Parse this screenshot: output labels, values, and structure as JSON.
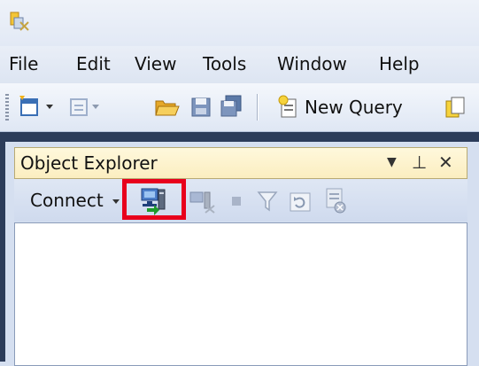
{
  "menu": [
    "File",
    "Edit",
    "View",
    "Tools",
    "Window",
    "Help"
  ],
  "toolbar": {
    "new_query_label": "New Query"
  },
  "object_explorer": {
    "title": "Object Explorer",
    "connect_label": "Connect",
    "highlight_color": "#e8001c"
  },
  "icons": {
    "app": "ssms-app-icon",
    "new_project": "new-project-icon",
    "add_item": "add-item-icon",
    "open": "open-folder-icon",
    "save": "save-icon",
    "save_all": "save-all-icon",
    "new_query": "new-query-icon",
    "copy": "copy-icon",
    "connect_dropdown": "dropdown-arrow-icon",
    "register": "connect-object-explorer-icon",
    "disconnect": "disconnect-icon",
    "stop": "stop-icon",
    "filter": "filter-icon",
    "refresh": "refresh-icon",
    "summary": "script-summary-icon"
  }
}
